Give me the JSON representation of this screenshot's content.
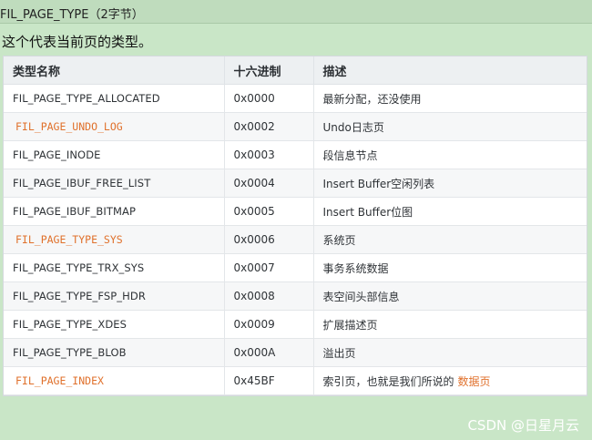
{
  "header": {
    "title": "FIL_PAGE_TYPE（2字节）",
    "description": "这个代表当前页的类型。"
  },
  "table": {
    "columns": [
      "类型名称",
      "十六进制",
      "描述"
    ],
    "rows": [
      {
        "name": "FIL_PAGE_TYPE_ALLOCATED",
        "hex": "0x0000",
        "desc": "最新分配，还没使用",
        "code_style": false
      },
      {
        "name": "FIL_PAGE_UNDO_LOG",
        "hex": "0x0002",
        "desc": "Undo日志页",
        "code_style": true
      },
      {
        "name": "FIL_PAGE_INODE",
        "hex": "0x0003",
        "desc": "段信息节点",
        "code_style": false
      },
      {
        "name": "FIL_PAGE_IBUF_FREE_LIST",
        "hex": "0x0004",
        "desc": "Insert Buffer空闲列表",
        "code_style": false
      },
      {
        "name": "FIL_PAGE_IBUF_BITMAP",
        "hex": "0x0005",
        "desc": "Insert Buffer位图",
        "code_style": false
      },
      {
        "name": "FIL_PAGE_TYPE_SYS",
        "hex": "0x0006",
        "desc": "系统页",
        "code_style": true
      },
      {
        "name": "FIL_PAGE_TYPE_TRX_SYS",
        "hex": "0x0007",
        "desc": "事务系统数据",
        "code_style": false
      },
      {
        "name": "FIL_PAGE_TYPE_FSP_HDR",
        "hex": "0x0008",
        "desc": "表空间头部信息",
        "code_style": false
      },
      {
        "name": "FIL_PAGE_TYPE_XDES",
        "hex": "0x0009",
        "desc": "扩展描述页",
        "code_style": false
      },
      {
        "name": "FIL_PAGE_TYPE_BLOB",
        "hex": "0x000A",
        "desc": "溢出页",
        "code_style": false
      },
      {
        "name": "FIL_PAGE_INDEX",
        "hex": "0x45BF",
        "desc": "索引页，也就是我们所说的",
        "desc_highlight": "数据页",
        "code_style": true
      }
    ]
  },
  "watermark": "CSDN @日星月云",
  "colors": {
    "background": "#c9e6c7",
    "code_accent": "#e0712c",
    "header_row": "#edf0f2"
  }
}
